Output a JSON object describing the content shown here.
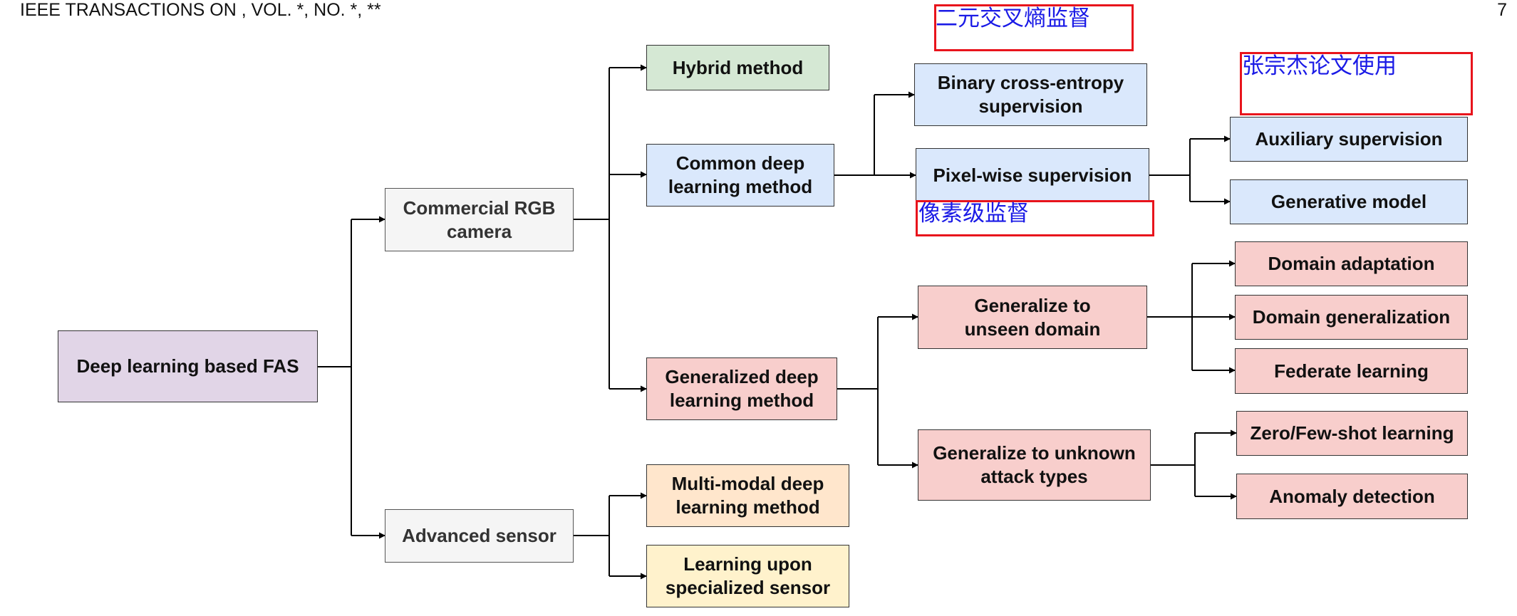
{
  "header": {
    "left": "IEEE TRANSACTIONS ON , VOL. *, NO. *, **",
    "page_number": "7"
  },
  "nodes": {
    "root": "Deep learning based FAS",
    "rgb_camera": "Commercial RGB\ncamera",
    "advanced_sensor": "Advanced sensor",
    "hybrid": "Hybrid method",
    "common_deep": "Common deep\nlearning method",
    "generalized_deep": "Generalized deep\nlearning method",
    "multimodal": "Multi-modal deep\nlearning method",
    "specialized_sensor": "Learning upon\nspecialized sensor",
    "binary_ce": "Binary cross-entropy\nsupervision",
    "pixel_wise": "Pixel-wise supervision",
    "auxiliary": "Auxiliary supervision",
    "generative": "Generative model",
    "unseen_domain": "Generalize to\nunseen domain",
    "unknown_attack": "Generalize to unknown\nattack types",
    "domain_adaptation": "Domain adaptation",
    "domain_generalization": "Domain generalization",
    "federate": "Federate learning",
    "zero_few_shot": "Zero/Few-shot learning",
    "anomaly": "Anomaly detection"
  },
  "annotations": {
    "binary_ce_cn": "二元交叉熵监督",
    "usage_note_cn": "张宗杰论文使用",
    "pixel_wise_cn": "像素级监督"
  },
  "colors": {
    "purple": "#e1d5e7",
    "gray": "#f5f5f5",
    "green": "#d5e8d4",
    "blue": "#dae8fc",
    "red": "#f8cecc",
    "orange": "#ffe6cc",
    "yellow": "#fff2cc",
    "annotation_border": "#e8141c",
    "annotation_text": "#1a1ae6"
  }
}
